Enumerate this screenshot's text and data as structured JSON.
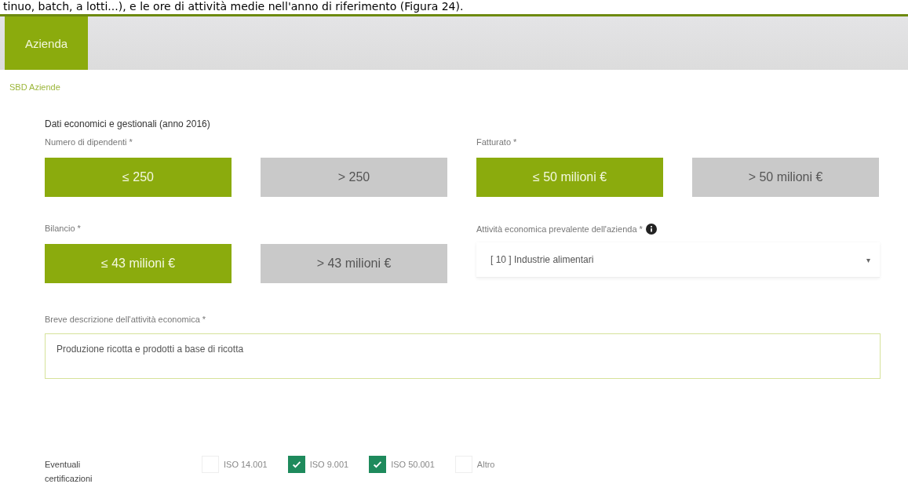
{
  "document_text": "tinuo, batch, a lotti...), e le ore di attività medie nell'anno di riferimento (Figura 24).",
  "tabs": [
    {
      "label": "Azienda",
      "selected": true
    }
  ],
  "breadcrumb": "SBD Aziende",
  "section_title": "Dati economici e gestionali (anno 2016)",
  "choice_groups": [
    {
      "label": "Numero di dipendenti *",
      "options": [
        {
          "label": "≤ 250",
          "selected": true
        },
        {
          "label": "> 250",
          "selected": false
        }
      ]
    },
    {
      "label": "Fatturato *",
      "options": [
        {
          "label": "≤ 50 milioni €",
          "selected": true
        },
        {
          "label": "> 50 milioni €",
          "selected": false
        }
      ]
    },
    {
      "label": "Bilancio *",
      "options": [
        {
          "label": "≤ 43 milioni €",
          "selected": true
        },
        {
          "label": "> 43 milioni €",
          "selected": false
        }
      ]
    }
  ],
  "activity": {
    "label": "Attività economica prevalente dell'azienda *",
    "value": "[ 10 ] Industrie alimentari",
    "caret": "▾"
  },
  "description": {
    "label": "Breve descrizione dell'attività economica *",
    "value": "Produzione ricotta e prodotti a base di ricotta"
  },
  "certifications": {
    "label": "Eventuali certificazioni",
    "options": [
      {
        "label": "ISO 14.001",
        "checked": false
      },
      {
        "label": "ISO 9.001",
        "checked": true
      },
      {
        "label": "ISO 50.001",
        "checked": true
      },
      {
        "label": "Altro",
        "checked": false
      }
    ]
  }
}
